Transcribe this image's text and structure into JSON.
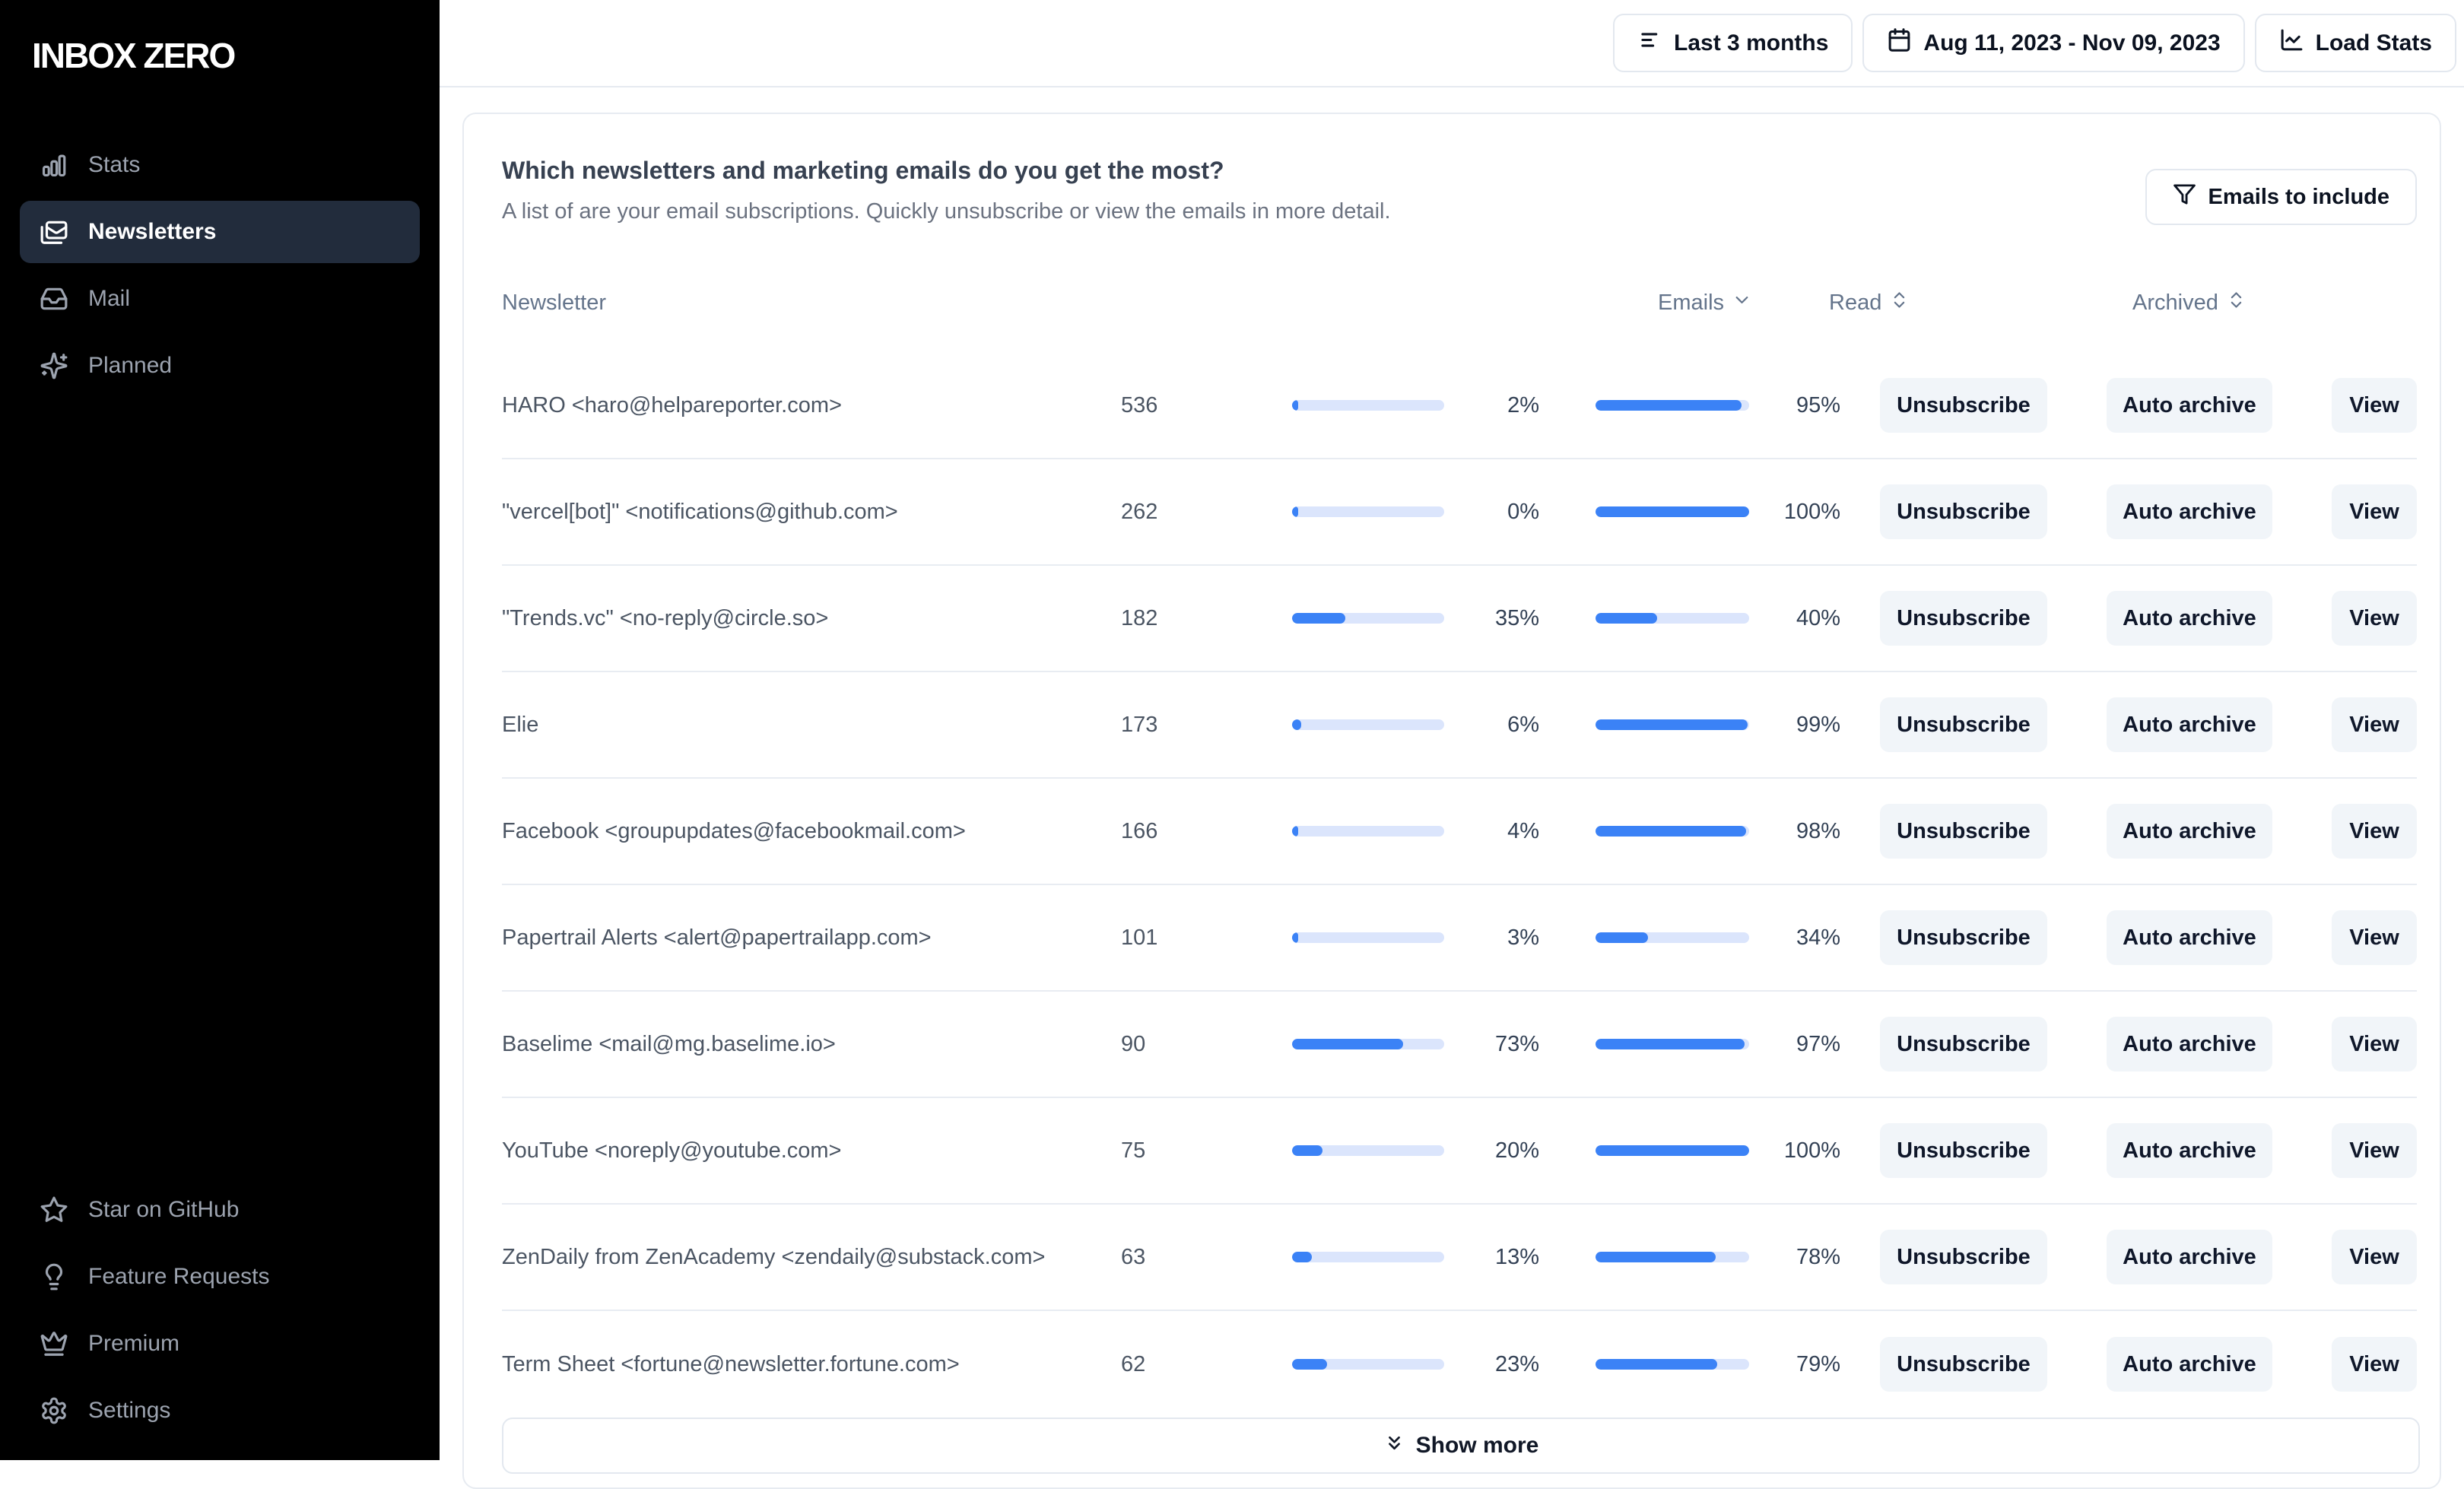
{
  "app": {
    "name": "INBOX ZERO"
  },
  "colors": {
    "sidebar_bg": "#000000",
    "sidebar_active_bg": "#222c3c",
    "accent_blue": "#3b82f6",
    "bar_track": "#dbe5fc",
    "action_button_bg": "#f1f5f9",
    "border": "#e3e8ef"
  },
  "sidebar": {
    "items": [
      {
        "label": "Stats",
        "icon": "bar-chart-icon",
        "active": false
      },
      {
        "label": "Newsletters",
        "icon": "newsletter-mail-icon",
        "active": true
      },
      {
        "label": "Mail",
        "icon": "inbox-icon",
        "active": false
      },
      {
        "label": "Planned",
        "icon": "sparkles-icon",
        "active": false
      }
    ],
    "footer_items": [
      {
        "label": "Star on GitHub",
        "icon": "star-icon"
      },
      {
        "label": "Feature Requests",
        "icon": "lightbulb-icon"
      },
      {
        "label": "Premium",
        "icon": "crown-icon"
      },
      {
        "label": "Settings",
        "icon": "gear-icon"
      }
    ]
  },
  "topbar": {
    "buttons": [
      {
        "label": "Last 3 months",
        "icon": "filter-lines-icon"
      },
      {
        "label": "Aug 11, 2023 - Nov 09, 2023",
        "icon": "calendar-icon"
      },
      {
        "label": "Load Stats",
        "icon": "line-chart-icon"
      }
    ]
  },
  "panel": {
    "title": "Which newsletters and marketing emails do you get the most?",
    "subtitle": "A list of are your email subscriptions. Quickly unsubscribe or view the emails in more detail.",
    "filter_button": {
      "label": "Emails to include",
      "icon": "funnel-icon"
    },
    "table": {
      "columns": [
        {
          "label": "Newsletter",
          "sort": null
        },
        {
          "label": "Emails",
          "sort": "desc"
        },
        {
          "label": "Read",
          "sort": "sortable"
        },
        {
          "label": "Archived",
          "sort": "sortable"
        }
      ],
      "row_actions": [
        "Unsubscribe",
        "Auto archive",
        "View"
      ],
      "rows": [
        {
          "name": "HARO <haro@helpareporter.com>",
          "emails": 536,
          "read_pct": 2,
          "archived_pct": 95
        },
        {
          "name": "\"vercel[bot]\" <notifications@github.com>",
          "emails": 262,
          "read_pct": 0,
          "archived_pct": 100
        },
        {
          "name": "\"Trends.vc\" <no-reply@circle.so>",
          "emails": 182,
          "read_pct": 35,
          "archived_pct": 40
        },
        {
          "name": "Elie",
          "emails": 173,
          "read_pct": 6,
          "archived_pct": 99
        },
        {
          "name": "Facebook <groupupdates@facebookmail.com>",
          "emails": 166,
          "read_pct": 4,
          "archived_pct": 98
        },
        {
          "name": "Papertrail Alerts <alert@papertrailapp.com>",
          "emails": 101,
          "read_pct": 3,
          "archived_pct": 34
        },
        {
          "name": "Baselime <mail@mg.baselime.io>",
          "emails": 90,
          "read_pct": 73,
          "archived_pct": 97
        },
        {
          "name": "YouTube <noreply@youtube.com>",
          "emails": 75,
          "read_pct": 20,
          "archived_pct": 100
        },
        {
          "name": "ZenDaily from ZenAcademy <zendaily@substack.com>",
          "emails": 63,
          "read_pct": 13,
          "archived_pct": 78
        },
        {
          "name": "Term Sheet <fortune@newsletter.fortune.com>",
          "emails": 62,
          "read_pct": 23,
          "archived_pct": 79
        }
      ],
      "show_more_label": "Show more"
    }
  }
}
